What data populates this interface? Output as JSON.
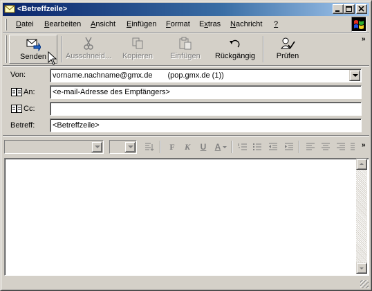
{
  "window": {
    "title": "<Betreffzeile>"
  },
  "menu": {
    "items": [
      {
        "label": "Datei",
        "accel": "D"
      },
      {
        "label": "Bearbeiten",
        "accel": "B"
      },
      {
        "label": "Ansicht",
        "accel": "A"
      },
      {
        "label": "Einfügen",
        "accel": "E"
      },
      {
        "label": "Format",
        "accel": "F"
      },
      {
        "label": "Extras",
        "accel": "x"
      },
      {
        "label": "Nachricht",
        "accel": "N"
      },
      {
        "label": "?",
        "accel": "?"
      }
    ]
  },
  "toolbar": {
    "send": "Senden",
    "cut": "Ausschneid...",
    "copy": "Kopieren",
    "paste": "Einfügen",
    "undo": "Rückgängig",
    "check": "Prüfen",
    "overflow": "»"
  },
  "header": {
    "from_label": "Von:",
    "from_value": "vorname.nachname@gmx.de",
    "from_account": "(pop.gmx.de (1))",
    "to_label": "An:",
    "to_value": "<e-mail-Adresse des Empfängers>",
    "cc_label": "Cc:",
    "cc_value": "",
    "subject_label": "Betreff:",
    "subject_value": "<Betreffzeile>"
  },
  "format_toolbar": {
    "font_name": "",
    "font_size": "",
    "bold": "F",
    "italic": "K",
    "underline": "U",
    "font_color": "A",
    "overflow": "»"
  },
  "body": {
    "text": ""
  },
  "colors": {
    "titlebar_start": "#0a246a",
    "titlebar_end": "#a6caf0",
    "face": "#d4d0c8"
  }
}
